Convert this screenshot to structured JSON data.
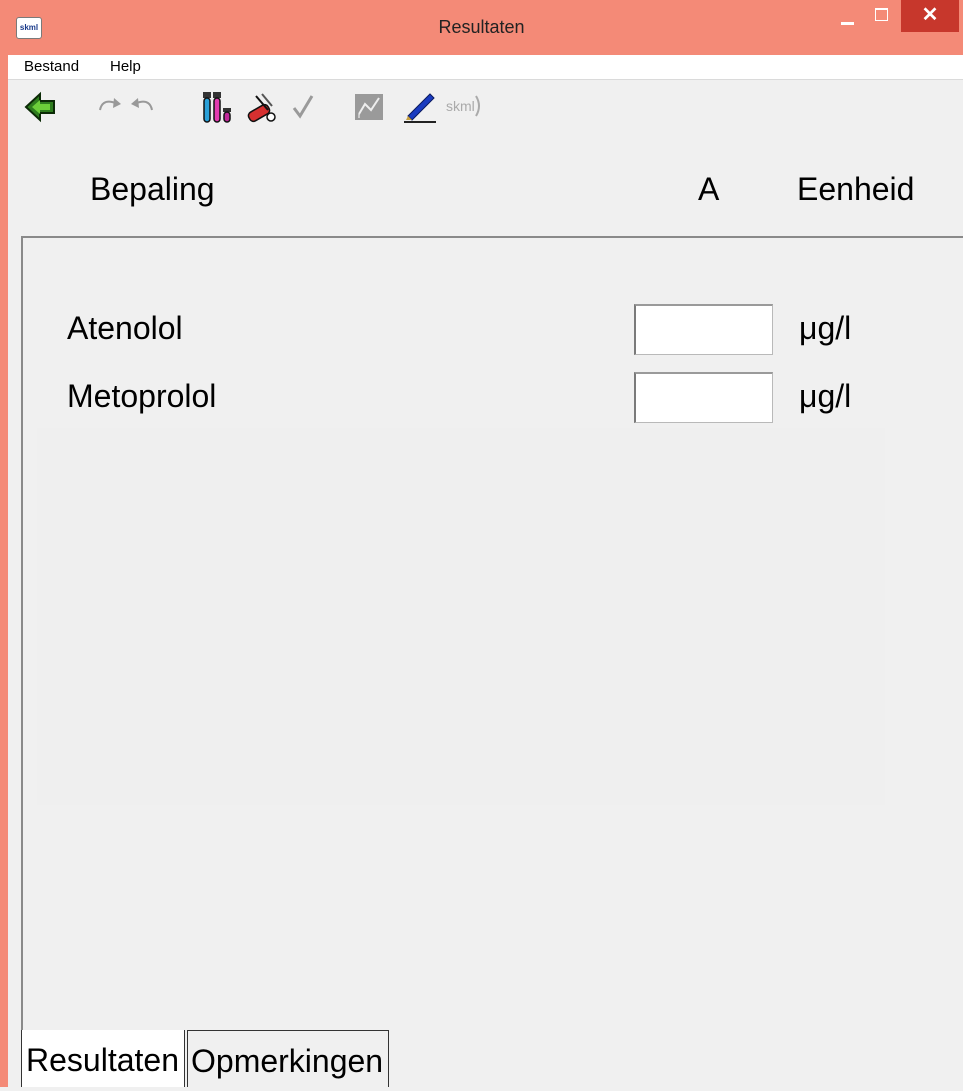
{
  "window": {
    "title": "Resultaten",
    "app_icon_label": "skml",
    "close_label": "✕",
    "accent_color": "#f48a77"
  },
  "menu": {
    "items": [
      {
        "label": "Bestand"
      },
      {
        "label": "Help"
      }
    ]
  },
  "toolbar": {
    "buttons": [
      {
        "icon": "back-arrow-icon"
      },
      {
        "icon": "redo-icon"
      },
      {
        "icon": "undo-icon"
      },
      {
        "icon": "test-tubes-icon"
      },
      {
        "icon": "measure-tools-icon"
      },
      {
        "icon": "checkmark-icon"
      },
      {
        "icon": "graph-tool-icon"
      },
      {
        "icon": "pen-icon"
      },
      {
        "icon": "skml-logo-icon"
      }
    ],
    "skml_label": "skml"
  },
  "table": {
    "headers": {
      "bepaling": "Bepaling",
      "a": "A",
      "eenheid": "Eenheid"
    },
    "rows": [
      {
        "label": "Atenolol",
        "value": "",
        "unit": "μg/l"
      },
      {
        "label": "Metoprolol",
        "value": "",
        "unit": "μg/l"
      }
    ]
  },
  "tabs": [
    {
      "label": "Resultaten",
      "active": true
    },
    {
      "label": "Opmerkingen",
      "active": false
    }
  ]
}
